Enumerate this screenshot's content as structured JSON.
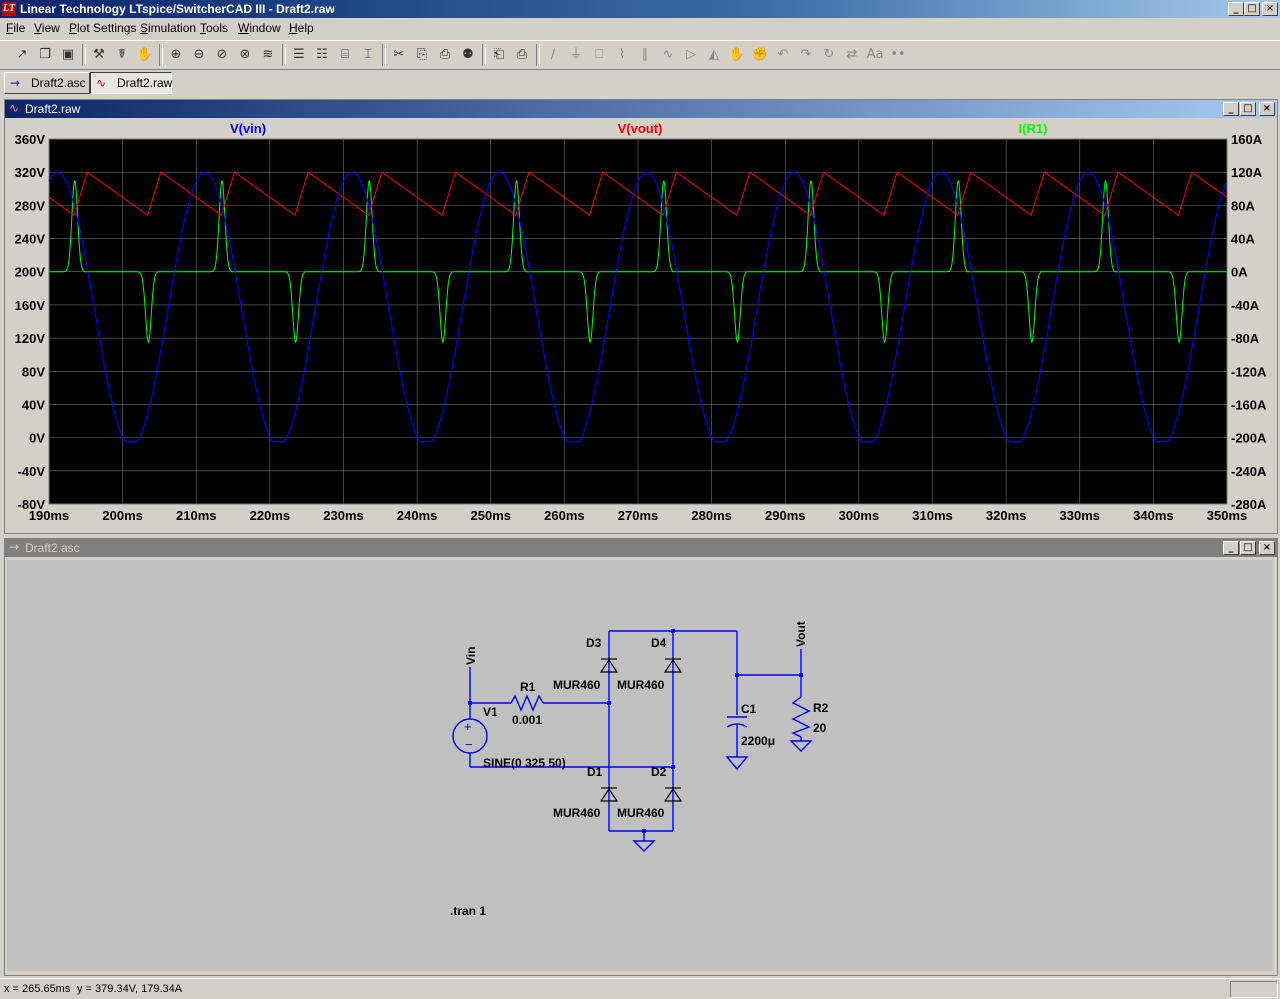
{
  "app": {
    "title": "Linear Technology LTspice/SwitcherCAD III - Draft2.raw",
    "logo": "LT",
    "window_buttons": [
      "_",
      "□",
      "×"
    ]
  },
  "menu": [
    {
      "hotkey": "F",
      "rest": "ile"
    },
    {
      "hotkey": "V",
      "rest": "iew"
    },
    {
      "hotkey": "P",
      "rest": "lot Settings"
    },
    {
      "hotkey": "S",
      "rest": "imulation"
    },
    {
      "hotkey": "T",
      "rest": "ools"
    },
    {
      "hotkey": "W",
      "rest": "indow"
    },
    {
      "hotkey": "H",
      "rest": "elp"
    }
  ],
  "toolbar": {
    "icons": [
      "new-schematic-icon",
      "open-icon",
      "save-icon",
      "control-panel-icon",
      "run-icon",
      "pan-icon",
      "zoom-in-icon",
      "zoom-out-icon",
      "zoom-fit-icon",
      "zoom-cancel-icon",
      "autorange-icon",
      "plot-pane-icon",
      "tile-horizontal-icon",
      "cascade-icon",
      "tile-vertical-icon",
      "cut-icon",
      "copy-icon",
      "paste-icon",
      "find-icon",
      "print-preview-icon",
      "print-icon",
      "wire-icon",
      "ground-icon",
      "label-icon",
      "resistor-icon",
      "capacitor-icon",
      "inductor-icon",
      "diode-icon",
      "component-icon",
      "move-icon",
      "drag-icon",
      "undo-icon",
      "redo-icon",
      "rotate-icon",
      "mirror-icon",
      "text-icon",
      "spice-directive-icon"
    ],
    "glyphs": [
      "↗",
      "❐",
      "▣",
      "⚒",
      "☤",
      "✋",
      "⊕",
      "⊖",
      "⊘",
      "⊗",
      "≋",
      "☰",
      "☷",
      "⌸",
      "⌶",
      "✂",
      "⎘",
      "⎙",
      "⚉",
      "⎗",
      "⎙",
      "∕",
      "⏚",
      "⎕",
      "⌇",
      "∥",
      "∿",
      "▷",
      "◭",
      "✋",
      "✊",
      "↶",
      "↷",
      "↻",
      "⇄",
      "Aa",
      "••"
    ]
  },
  "tabs": [
    {
      "label": "Draft2.asc",
      "icon": "schematic-icon",
      "glyph": "→"
    },
    {
      "label": "Draft2.raw",
      "icon": "waveform-icon",
      "glyph": "∿"
    }
  ],
  "plot_window": {
    "title": "Draft2.raw",
    "icon": "waveform-icon",
    "glyph": "∿",
    "buttons": [
      "_",
      "□",
      "×"
    ]
  },
  "chart_data": {
    "type": "line",
    "title": "",
    "xlabel": "",
    "ylabel": "",
    "xlim": [
      190,
      350
    ],
    "x_unit": "ms",
    "ylim_left": [
      -80,
      360
    ],
    "ylim_right": [
      -280,
      160
    ],
    "grid": true,
    "background": "#000000",
    "x_ticks": [
      "190ms",
      "200ms",
      "210ms",
      "220ms",
      "230ms",
      "240ms",
      "250ms",
      "260ms",
      "270ms",
      "280ms",
      "290ms",
      "300ms",
      "310ms",
      "320ms",
      "330ms",
      "340ms",
      "350ms"
    ],
    "y_left_ticks": [
      "360V",
      "320V",
      "280V",
      "240V",
      "200V",
      "160V",
      "120V",
      "80V",
      "40V",
      "0V",
      "-40V",
      "-80V"
    ],
    "y_right_ticks": [
      "160A",
      "120A",
      "80A",
      "40A",
      "0A",
      "-40A",
      "-80A",
      "-120A",
      "-160A",
      "-200A",
      "-240A",
      "-280A"
    ],
    "series": [
      {
        "name": "V(vin)",
        "color": "#0000ff",
        "axis": "left",
        "description": "sine 0..325V, 50Hz, peaks near 195,215,235 ms etc.",
        "frequency_hz": 50,
        "offset_v": 160,
        "amplitude_v": 165
      },
      {
        "name": "V(vout)",
        "color": "#ff0000",
        "axis": "left",
        "description": "rectified output, peaks ~320V, decays to ~268V between charges",
        "peak_v": 320,
        "valley_v": 268
      },
      {
        "name": "I(R1)",
        "color": "#00ff00",
        "axis": "right",
        "description": "charging current pulses, +110A and -85A alternating every 10ms",
        "pos_peak_a": 110,
        "neg_peak_a": -85
      }
    ]
  },
  "schematic_window": {
    "title": "Draft2.asc",
    "icon": "schematic-icon",
    "glyph": "→",
    "buttons": [
      "_",
      "□",
      "×"
    ]
  },
  "schematic": {
    "labels": {
      "vin": "Vin",
      "vout": "Vout",
      "r1": "R1",
      "r1_value": "0.001",
      "v1": "V1",
      "v1_value": "SINE(0 325 50)",
      "d1": "D1",
      "d2": "D2",
      "d3": "D3",
      "d4": "D4",
      "d1_model": "MUR460",
      "d2_model": "MUR460",
      "d3_model": "MUR460",
      "d4_model": "MUR460",
      "c1": "C1",
      "c1_value": "2200μ",
      "r2": "R2",
      "r2_value": "20",
      "directive": ".tran 1"
    }
  },
  "status": {
    "x": "x = 265.65ms",
    "y": "y = 379.34V, 179.34A"
  },
  "colors": {
    "title_active": "#0a246a",
    "title_inactive": "#808080",
    "schematic_bg": "#c0c0c0",
    "wire": "#0000ff",
    "vin_trace": "#0000ff",
    "vout_trace": "#ff0000",
    "ir1_trace": "#00ff00",
    "grid": "#707070"
  }
}
